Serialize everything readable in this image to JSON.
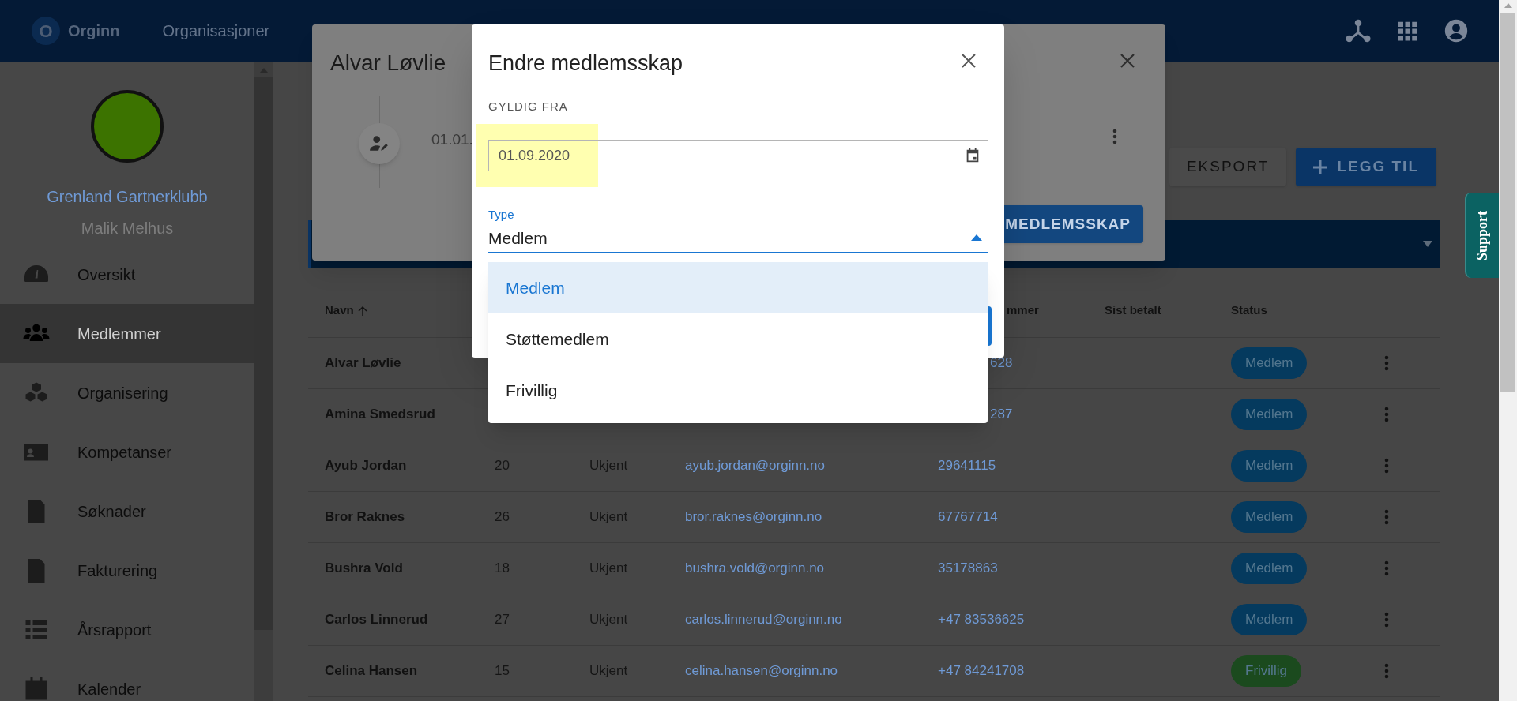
{
  "header": {
    "logo_letter": "O",
    "brand": "Orginn",
    "nav": [
      {
        "label": "Organisasjoner"
      }
    ]
  },
  "sidebar": {
    "organization": "Grenland Gartnerklubb",
    "user": "Malik Melhus",
    "items": [
      {
        "label": "Oversikt",
        "selected": false
      },
      {
        "label": "Medlemmer",
        "selected": true
      },
      {
        "label": "Organisering",
        "selected": false
      },
      {
        "label": "Kompetanser",
        "selected": false
      },
      {
        "label": "Søknader",
        "selected": false
      },
      {
        "label": "Fakturering",
        "selected": false
      },
      {
        "label": "Årsrapport",
        "selected": false
      },
      {
        "label": "Kalender",
        "selected": false
      }
    ]
  },
  "actions": [
    {
      "kind": "plain",
      "label": "EKSPORT"
    },
    {
      "kind": "add",
      "label": "LEGG TIL"
    }
  ],
  "support_tab": "Support",
  "table": {
    "columns": [
      {
        "label": "Navn",
        "sorted": true
      },
      {
        "label": "mmer",
        "sorted": false
      },
      {
        "label": "Sist betalt",
        "sorted": false
      },
      {
        "label": "Status",
        "sorted": false
      }
    ],
    "rows": [
      {
        "name": "Alvar Løvlie",
        "phone_tail": "628",
        "status": {
          "label": "Medlem",
          "color": "#053a5e"
        }
      },
      {
        "name": "Amina Smedsrud",
        "phone_tail": "287",
        "status": {
          "label": "Medlem",
          "color": "#053a5e"
        }
      },
      {
        "name": "Ayub Jordan",
        "age": "20",
        "col_3": "Ukjent",
        "email": "ayub.jordan@orginn.no",
        "phone": "29641115",
        "status": {
          "label": "Medlem",
          "color": "#053a5e"
        }
      },
      {
        "name": "Bror Raknes",
        "age": "26",
        "col_3": "Ukjent",
        "email": "bror.raknes@orginn.no",
        "phone": "67767714",
        "status": {
          "label": "Medlem",
          "color": "#053a5e"
        }
      },
      {
        "name": "Bushra Vold",
        "age": "18",
        "col_3": "Ukjent",
        "email": "bushra.vold@orginn.no",
        "phone": "35178863",
        "status": {
          "label": "Medlem",
          "color": "#053a5e"
        }
      },
      {
        "name": "Carlos Linnerud",
        "age": "27",
        "col_3": "Ukjent",
        "email": "carlos.linnerud@orginn.no",
        "phone": "+47 83536625",
        "status": {
          "label": "Medlem",
          "color": "#053a5e"
        }
      },
      {
        "name": "Celina Hansen",
        "age": "15",
        "col_3": "Ukjent",
        "email": "celina.hansen@orginn.no",
        "phone": "+47 84241708",
        "status": {
          "label": "Frivillig",
          "color": "#1b4a1e"
        }
      }
    ]
  },
  "member_dialog": {
    "title": "Alvar Løvlie",
    "entry_date": "01.01.",
    "button": "MEDLEMSSKAP"
  },
  "edit_dialog": {
    "title": "Endre medlemsskap",
    "valid_from": {
      "label": "GYLDIG FRA",
      "value": "01.09.2020",
      "highlighted": true
    },
    "type": {
      "label": "Type",
      "value": "Medlem",
      "expanded": true,
      "options": [
        {
          "label": "Medlem",
          "selected": true
        },
        {
          "label": "Støttemedlem",
          "selected": false
        },
        {
          "label": "Frivillig",
          "selected": false
        }
      ]
    }
  }
}
